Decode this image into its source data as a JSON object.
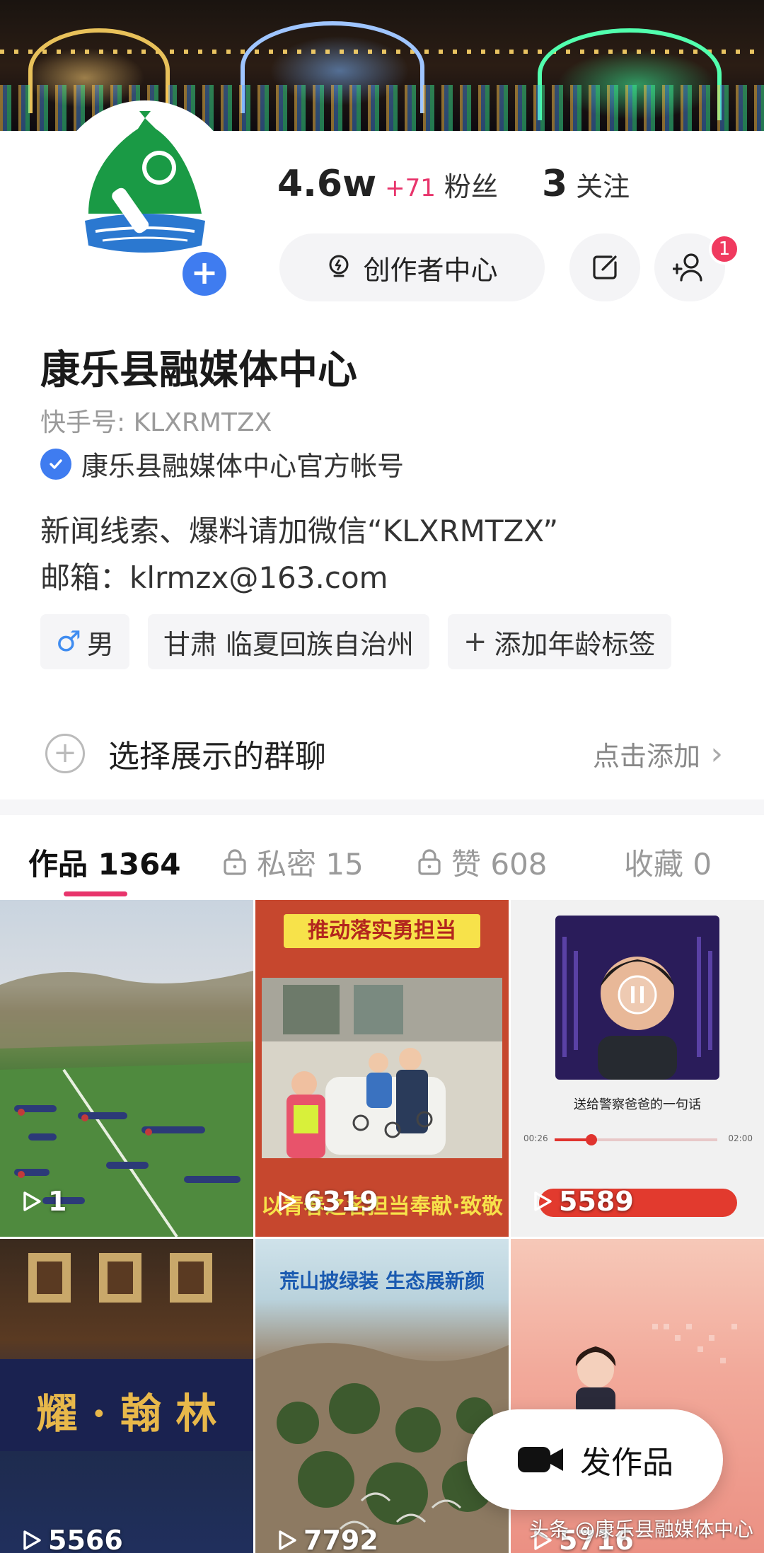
{
  "profile": {
    "followers": "4.6w",
    "followers_delta": "+71",
    "followers_label": "粉丝",
    "following": "3",
    "following_label": "关注",
    "creator_center_label": "创作者中心",
    "notification_badge": "1",
    "name": "康乐县融媒体中心",
    "account_id": "快手号: KLXRMTZX",
    "verified_text": "康乐县融媒体中心官方帐号",
    "bio_line1": "新闻线索、爆料请加微信“KLXRMTZX”",
    "bio_line2": "邮箱：klrmzx@163.com"
  },
  "tags": {
    "gender": "男",
    "location": "甘肃 临夏回族自治州",
    "add_age": "添加年龄标签"
  },
  "group_chat": {
    "label": "选择展示的群聊",
    "action": "点击添加"
  },
  "tabs": [
    {
      "label": "作品 1364"
    },
    {
      "label": "私密 15"
    },
    {
      "label": "赞 608"
    },
    {
      "label": "收藏 0"
    }
  ],
  "videos": [
    {
      "plays": "1"
    },
    {
      "plays": "6319",
      "caption_top": "推动落实勇担当",
      "caption_bottom": "以青春之名担当奉献·致敬"
    },
    {
      "plays": "5589",
      "caption": "送给警察爸爸的一句话",
      "time_start": "00:26",
      "time_end": "02:00"
    },
    {
      "plays": "5566",
      "caption": "耀 · 翰 林"
    },
    {
      "plays": "7792",
      "caption": "荒山披绿装  生态展新颜"
    },
    {
      "plays": "5716"
    }
  ],
  "fab_label": "发作品",
  "watermark": "头条 @康乐县融媒体中心",
  "colors": {
    "accent": "#e8356c",
    "verified_blue": "#3f7cf0",
    "badge_red": "#f03a5f"
  }
}
